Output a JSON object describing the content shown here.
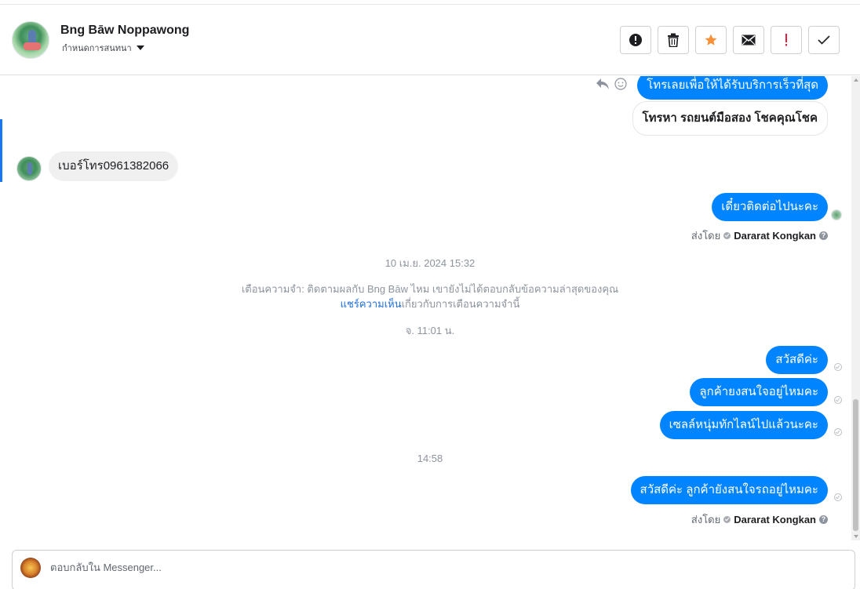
{
  "header": {
    "contact_name": "Bng Bāw Noppawong",
    "conversation_settings": "กำหนดการสนทนา",
    "actions": [
      {
        "name": "spam-button",
        "label": "!",
        "icon": "alert-circle-icon"
      },
      {
        "name": "delete-button",
        "label": "",
        "icon": "trash-icon"
      },
      {
        "name": "star-button",
        "label": "★",
        "icon": "star-icon",
        "color": "#f7923b"
      },
      {
        "name": "mark-unread-button",
        "label": "",
        "icon": "envelope-icon"
      },
      {
        "name": "follow-up-button",
        "label": "!",
        "icon": "exclamation-icon",
        "color": "#e41e3f"
      },
      {
        "name": "done-button",
        "label": "✓",
        "icon": "check-icon"
      }
    ]
  },
  "messages": {
    "quoted_ad_text": "โทรเลยเพื่อให้ได้รับบริการเร็วที่สุด",
    "quoted_card_title": "โทรหา รถยนต์มือสอง โชคคุณโชค",
    "incoming_phone": "เบอร์โทร0961382066",
    "reply_1": "เดี๋ยวติดต่อไปนะคะ",
    "sent_by_1_prefix": "ส่งโดย",
    "sent_by_1_agent": "Dararat Kongkan",
    "timestamp_1": "10 เม.ย. 2024 15:32",
    "reminder_text": "เตือนความจำ: ติดตามผลกับ Bng Bāw ไหม เขายังไม่ได้ตอบกลับข้อความล่าสุดของคุณ",
    "reminder_link": "แชร์ความเห็น",
    "reminder_link_suffix": "เกี่ยวกับการเตือนความจำนี้",
    "timestamp_2": "จ. 11:01 น.",
    "reply_2": "สวัสดีค่ะ",
    "reply_3": "ลูกค้ายงสนใจอยู่ไหมคะ",
    "reply_4": "เซลล์หนุ่มทักไลน์ไปแล้วนะคะ",
    "timestamp_3": "14:58",
    "reply_5": "สวัสดีค่ะ ลูกค้ายังสนใจรถอยู่ไหมคะ",
    "sent_by_2_prefix": "ส่งโดย",
    "sent_by_2_agent": "Dararat Kongkan"
  },
  "composer": {
    "placeholder": "ตอบกลับใน Messenger..."
  },
  "colors": {
    "outgoing_bubble": "#0084ff",
    "incoming_bubble": "#f0f0f0",
    "accent": "#1877f2"
  }
}
